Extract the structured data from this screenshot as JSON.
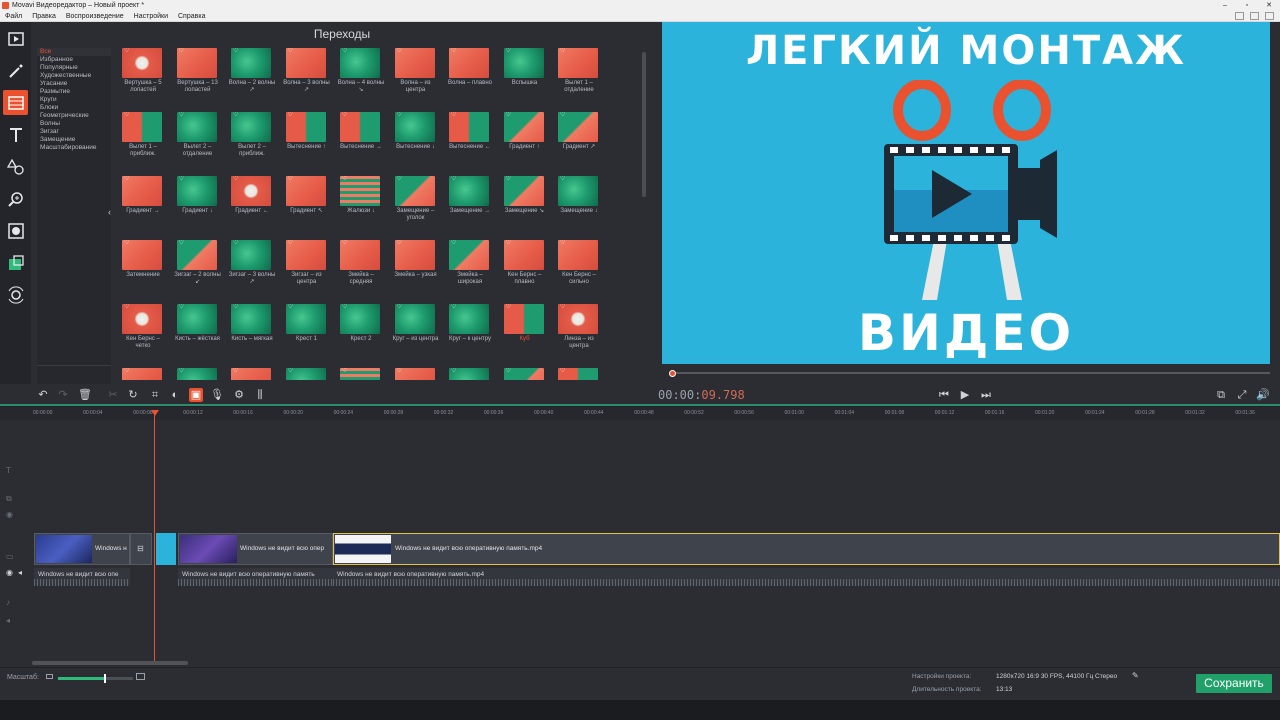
{
  "window": {
    "title": "Movavi Видеоредактор – Новый проект *"
  },
  "menu": [
    "Файл",
    "Правка",
    "Воспроизведение",
    "Настройки",
    "Справка"
  ],
  "left_tools": [
    {
      "icon": "import-icon"
    },
    {
      "icon": "magic-wand-icon"
    },
    {
      "icon": "transitions-icon"
    },
    {
      "icon": "titles-icon"
    },
    {
      "icon": "shapes-icon"
    },
    {
      "icon": "zoom-icon"
    },
    {
      "icon": "overlay-icon"
    },
    {
      "icon": "sticker-icon"
    },
    {
      "icon": "camera-icon"
    }
  ],
  "panel": {
    "title": "Переходы",
    "categories": [
      "Все",
      "Избранное",
      "Популярные",
      "Художественные",
      "Угасание",
      "Размытие",
      "Круги",
      "Блоки",
      "Геометрические",
      "Волны",
      "Зигзаг",
      "Замещение",
      "Масштабирование"
    ],
    "active_category": "Все",
    "items": [
      {
        "label": "Вертушка – 5 лопастей",
        "style": "flower"
      },
      {
        "label": "Вертушка – 13 лопастей",
        "style": "coral"
      },
      {
        "label": "Волна – 2 волны ↗",
        "style": "green"
      },
      {
        "label": "Волна – 3 волны ↗",
        "style": "coral"
      },
      {
        "label": "Волна – 4 волны ↘",
        "style": "green"
      },
      {
        "label": "Волна – из центра",
        "style": "coral"
      },
      {
        "label": "Волна – плавно",
        "style": "coral"
      },
      {
        "label": "Вспышка",
        "style": "green"
      },
      {
        "label": "Вылет 1 – отдаление",
        "style": "coral"
      },
      {
        "label": "Вылет 1 – приближ.",
        "style": "split"
      },
      {
        "label": "Вылет 2 – отдаление",
        "style": "green"
      },
      {
        "label": "Вылет 2 – приближ.",
        "style": "green"
      },
      {
        "label": "Вытеснение ↑",
        "style": "split"
      },
      {
        "label": "Вытеснение →",
        "style": "split"
      },
      {
        "label": "Вытеснение ↓",
        "style": "green"
      },
      {
        "label": "Вытеснение ←",
        "style": "split"
      },
      {
        "label": "Градиент ↑",
        "style": "diag"
      },
      {
        "label": "Градиент ↗",
        "style": "diag"
      },
      {
        "label": "Градиент →",
        "style": "coral"
      },
      {
        "label": "Градиент ↓",
        "style": "green"
      },
      {
        "label": "Градиент ←",
        "style": "flower"
      },
      {
        "label": "Градиент ↖",
        "style": "coral"
      },
      {
        "label": "Жалюзи ↓",
        "style": "bars"
      },
      {
        "label": "Замещение – уголок",
        "style": "diag"
      },
      {
        "label": "Замещение →",
        "style": "green"
      },
      {
        "label": "Замещение ↘",
        "style": "diag"
      },
      {
        "label": "Замещение ↓",
        "style": "green"
      },
      {
        "label": "Затемнение",
        "style": "coral"
      },
      {
        "label": "Зигзаг – 2 волны ↙",
        "style": "diag"
      },
      {
        "label": "Зигзаг – 3 волны ↗",
        "style": "green"
      },
      {
        "label": "Зигзаг – из центра",
        "style": "coral"
      },
      {
        "label": "Змейка – средняя",
        "style": "coral"
      },
      {
        "label": "Змейка – узкая",
        "style": "coral"
      },
      {
        "label": "Змейка – широкая",
        "style": "diag"
      },
      {
        "label": "Кен Бернс – плавно",
        "style": "coral"
      },
      {
        "label": "Кен Бернс – сильно",
        "style": "coral"
      },
      {
        "label": "Кен Бернс – четко",
        "style": "flower"
      },
      {
        "label": "Кисть – жёсткая",
        "style": "green"
      },
      {
        "label": "Кисть – мягкая",
        "style": "green"
      },
      {
        "label": "Крест 1",
        "style": "green"
      },
      {
        "label": "Крест 2",
        "style": "green"
      },
      {
        "label": "Круг – из центра",
        "style": "green"
      },
      {
        "label": "Круг – к центру",
        "style": "green"
      },
      {
        "label": "Куб",
        "style": "split",
        "accent": true
      },
      {
        "label": "Линза – из центра",
        "style": "flower"
      },
      {
        "label": "",
        "style": "coral"
      },
      {
        "label": "",
        "style": "green"
      },
      {
        "label": "",
        "style": "coral"
      },
      {
        "label": "",
        "style": "green"
      },
      {
        "label": "",
        "style": "bars"
      },
      {
        "label": "",
        "style": "coral"
      },
      {
        "label": "",
        "style": "green"
      },
      {
        "label": "",
        "style": "diag"
      },
      {
        "label": "",
        "style": "split"
      }
    ]
  },
  "preview": {
    "headline": "ЛЕГКИЙ МОНТАЖ",
    "subline": "ВИДЕО",
    "background": "#2bb3db",
    "progress_fraction": 0.005
  },
  "player": {
    "time_main": "00:00:",
    "time_frac": "09.798"
  },
  "ruler_ticks": [
    "00:00:00",
    "00:00:04",
    "00:00:08",
    "00:00:12",
    "00:00:16",
    "00:00:20",
    "00:00:24",
    "00:00:28",
    "00:00:32",
    "00:00:36",
    "00:00:40",
    "00:00:44",
    "00:00:48",
    "00:00:52",
    "00:00:56",
    "00:01:00",
    "00:01:04",
    "00:01:08",
    "00:01:12",
    "00:01:16",
    "00:01:20",
    "00:01:24",
    "00:01:28",
    "00:01:32",
    "00:01:36"
  ],
  "timeline": {
    "clip1_label": "Windows н",
    "clip2_label": "Windows не видит всю опер",
    "clip3_label": "Windows не видит всю оперативную память.mp4",
    "audio1_label": "Windows не видит всю опе",
    "audio2_label": "Windows не видит всю оперативную память",
    "audio3_label": "Windows не видит всю оперативную память.mp4"
  },
  "status": {
    "zoom_label": "Масштаб:",
    "zoom_fraction": 0.62,
    "settings_label": "Настройки проекта:",
    "settings_value": "1280x720 16:9 30 FPS, 44100 Гц Стерео",
    "length_label": "Длительность проекта:",
    "length_value": "13:13",
    "save_label": "Сохранить"
  },
  "colors": {
    "accent": "#e9512f",
    "save": "#21a16a",
    "timeline_green": "#2f8a6b"
  }
}
